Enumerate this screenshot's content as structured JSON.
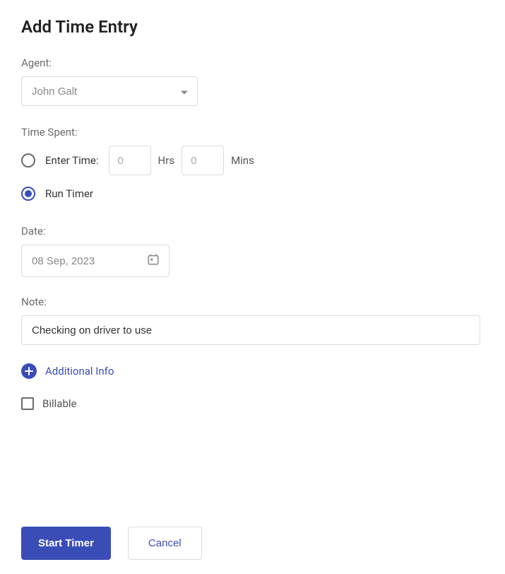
{
  "title": "Add Time Entry",
  "agent": {
    "label": "Agent:",
    "value": "John Galt"
  },
  "timeSpent": {
    "label": "Time Spent:",
    "enterTimeLabel": "Enter Time:",
    "hrsPlaceholder": "0",
    "hrsUnit": "Hrs",
    "minsPlaceholder": "0",
    "minsUnit": "Mins",
    "runTimerLabel": "Run Timer",
    "selected": "run"
  },
  "date": {
    "label": "Date:",
    "value": "08 Sep, 2023"
  },
  "note": {
    "label": "Note:",
    "value": "Checking on driver to use"
  },
  "additionalInfoLabel": "Additional Info",
  "billableLabel": "Billable",
  "billableChecked": false,
  "buttons": {
    "primary": "Start Timer",
    "secondary": "Cancel"
  }
}
